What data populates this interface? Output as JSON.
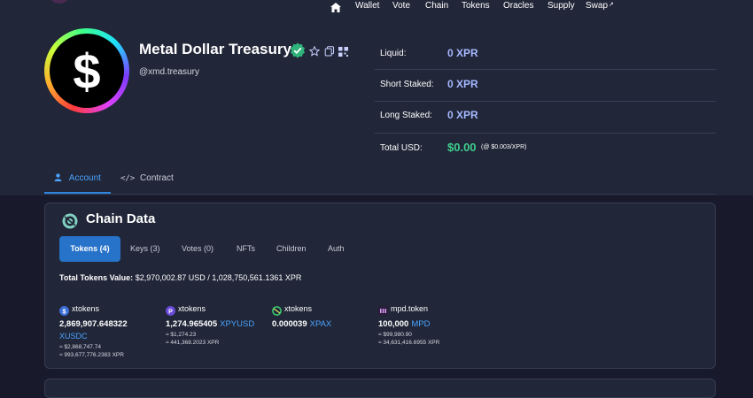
{
  "nav": {
    "items": [
      "Wallet",
      "Vote",
      "Chain",
      "Tokens",
      "Oracles",
      "Supply",
      "Swap"
    ]
  },
  "account": {
    "name": "Metal Dollar Treasury",
    "handle": "@xmd.treasury",
    "avatar_symbol": "$",
    "verified_color": "#2fb37a"
  },
  "balances": {
    "liquid_label": "Liquid:",
    "liquid_value": "0 XPR",
    "short_label": "Short Staked:",
    "short_value": "0 XPR",
    "long_label": "Long Staked:",
    "long_value": "0 XPR",
    "usd_label": "Total USD:",
    "usd_value": "$0.00",
    "usd_note": "(@ $0.003/XPR)"
  },
  "tabs": {
    "account": "Account",
    "contract": "Contract"
  },
  "chain_data": {
    "title": "Chain Data",
    "subtabs": [
      "Tokens (4)",
      "Keys (3)",
      "Votes (0)",
      "NFTs",
      "Children",
      "Auth"
    ],
    "total_label": "Total Tokens Value:",
    "total_value": "$2,970,002.87 USD / 1,028,750,561.1361 XPR",
    "tokens": [
      {
        "contract": "xtokens",
        "amount": "2,869,907.648322",
        "symbol": "XUSDC",
        "usd": "≈ $2,868,747.74",
        "xpr": "≈ 993,677,776.2383 XPR",
        "icon": "usdc-icon",
        "color": "#3b6fd6"
      },
      {
        "contract": "xtokens",
        "amount": "1,274.965405",
        "symbol": "XPYUSD",
        "usd": "≈ $1,274.23",
        "xpr": "≈ 441,368.2023 XPR",
        "icon": "pyusd-icon",
        "color": "#6a4bd8"
      },
      {
        "contract": "xtokens",
        "amount": "0.000039",
        "symbol": "XPAX",
        "icon": "pax-icon",
        "color": "#39c06b"
      },
      {
        "contract": "mpd.token",
        "amount": "100,000",
        "symbol": "MPD",
        "usd": "≈ $99,980.90",
        "xpr": "≈ 34,631,416.6955 XPR",
        "icon": "mpd-icon",
        "color": "#2a1d3a"
      }
    ]
  }
}
